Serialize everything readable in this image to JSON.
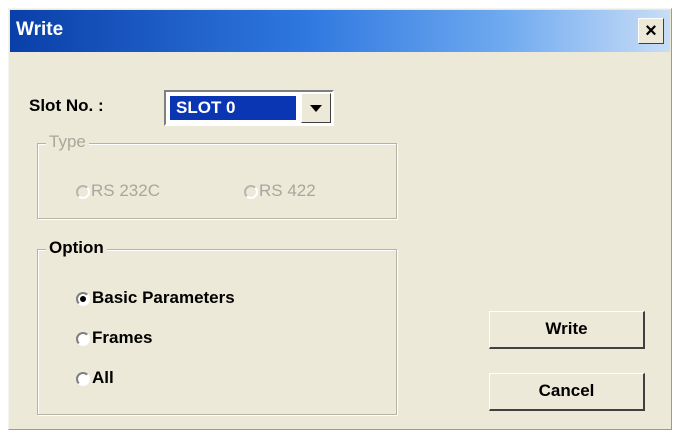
{
  "window": {
    "title": "Write",
    "close_glyph": "×"
  },
  "slot": {
    "label": "Slot No. :",
    "selected": "SLOT 0"
  },
  "type_group": {
    "title": "Type",
    "options": [
      {
        "label": "RS 232C",
        "checked": false,
        "disabled": true
      },
      {
        "label": "RS 422",
        "checked": false,
        "disabled": true
      }
    ]
  },
  "option_group": {
    "title": "Option",
    "options": [
      {
        "label": "Basic Parameters",
        "checked": true
      },
      {
        "label": "Frames",
        "checked": false
      },
      {
        "label": "All",
        "checked": false
      }
    ]
  },
  "buttons": {
    "write": "Write",
    "cancel": "Cancel"
  }
}
